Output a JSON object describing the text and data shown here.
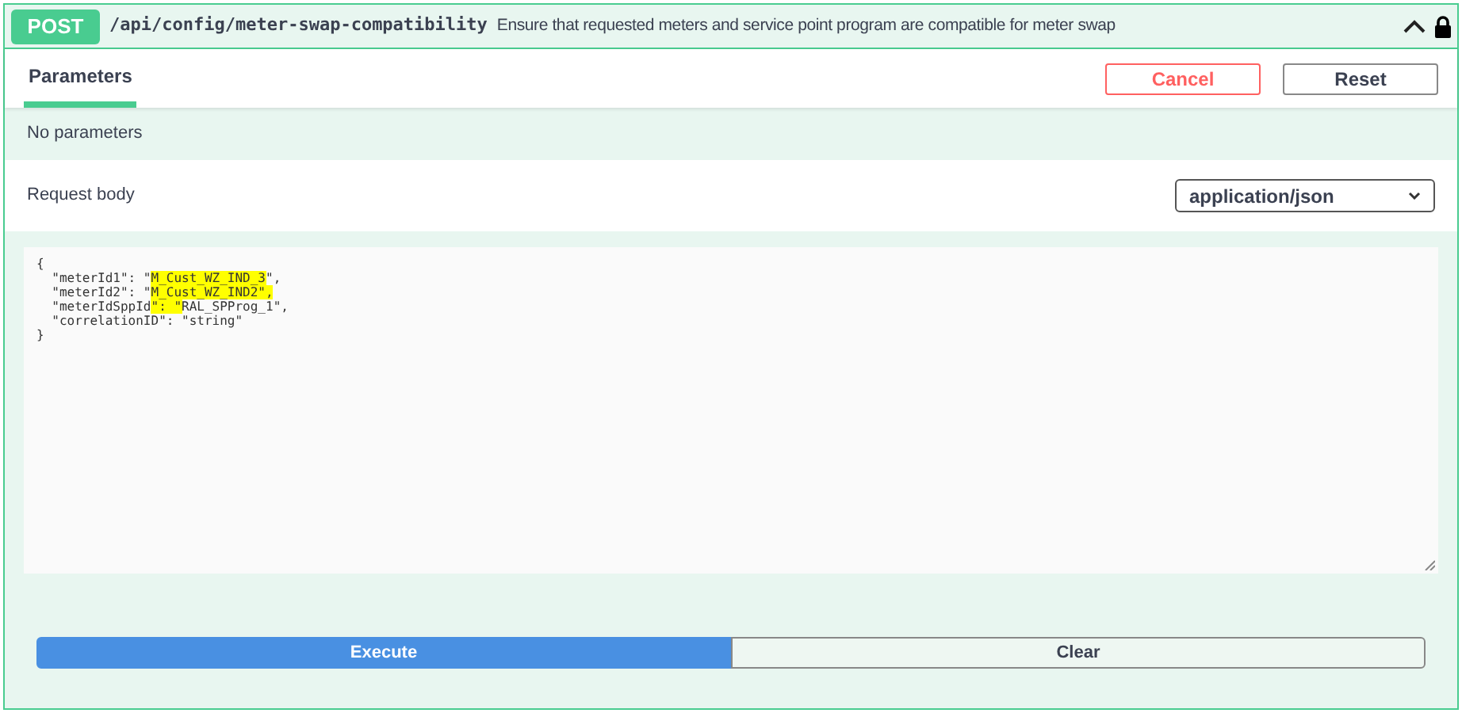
{
  "operation": {
    "method": "POST",
    "path": "/api/config/meter-swap-compatibility",
    "summary": "Ensure that requested meters and service point program are compatible for meter swap",
    "expanded": true,
    "locked": true
  },
  "tabs": [
    {
      "label": "Parameters",
      "selected": true
    }
  ],
  "buttons": {
    "cancel": "Cancel",
    "reset": "Reset"
  },
  "parameters_message": "No parameters",
  "request_body": {
    "label": "Request body",
    "content_type": "application/json"
  },
  "body_lines": [
    [
      {
        "text": "{",
        "highlighted": false
      }
    ],
    [
      {
        "text": "  \"meterId1\": \"",
        "highlighted": false
      },
      {
        "text": "M_Cust_WZ_IND_3",
        "highlighted": true
      },
      {
        "text": "\",",
        "highlighted": false
      }
    ],
    [
      {
        "text": "  \"meterId2\": \"",
        "highlighted": false
      },
      {
        "text": "M_Cust_WZ_IND2\",",
        "highlighted": true
      }
    ],
    [
      {
        "text": "  \"meterIdSppId",
        "highlighted": false
      },
      {
        "text": "\": \"",
        "highlighted": true
      },
      {
        "text": "RAL_SPProg_1\",",
        "highlighted": false
      }
    ],
    [
      {
        "text": "  \"correlationID\": \"string\"",
        "highlighted": false
      }
    ],
    [
      {
        "text": "}",
        "highlighted": false
      }
    ]
  ],
  "actions": {
    "execute": "Execute",
    "clear": "Clear"
  }
}
